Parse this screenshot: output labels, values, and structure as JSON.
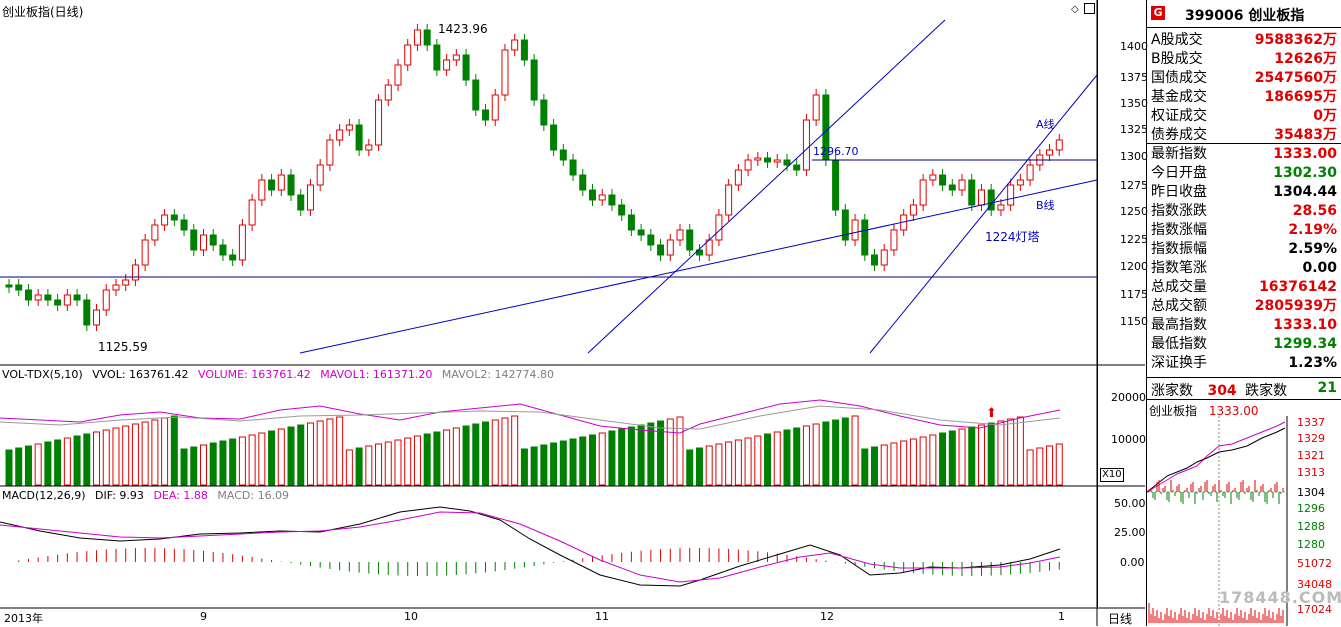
{
  "main_chart": {
    "title": "创业板指(日线)",
    "annotations": {
      "high_label": "1423.96",
      "low_label": "1125.59",
      "level_label": "1296.70",
      "a_line": "A线",
      "b_line": "B线",
      "lamp_label": "1224灯塔"
    },
    "y_ticks": [
      "1400",
      "1375",
      "1350",
      "1325",
      "1300",
      "1275",
      "1250",
      "1225",
      "1200",
      "1175",
      "1150"
    ]
  },
  "volume_panel": {
    "title": "VOL-TDX(5,10)",
    "vvol_label": "VVOL: 163761.42",
    "volume_label": "VOLUME: 163761.42",
    "mavol1_label": "MAVOL1: 161371.20",
    "mavol2_label": "MAVOL2: 142774.80",
    "y_ticks": [
      "20000",
      "10000"
    ],
    "scale_badge": "X10"
  },
  "macd_panel": {
    "title": "MACD(12,26,9)",
    "dif_label": "DIF: 9.93",
    "dea_label": "DEA: 1.88",
    "macd_label": "MACD: 16.09",
    "y_ticks": [
      "50.00",
      "25.00",
      "0.00"
    ]
  },
  "x_axis": {
    "labels": [
      "2013年",
      "9",
      "10",
      "11",
      "12",
      "1"
    ],
    "period_label": "日线"
  },
  "quote": {
    "badge": "G",
    "code": "399006",
    "name": "创业板指",
    "rows": [
      {
        "label": "A股成交",
        "value": "9588362万",
        "color": "red"
      },
      {
        "label": "B股成交",
        "value": "12626万",
        "color": "red"
      },
      {
        "label": "国债成交",
        "value": "2547560万",
        "color": "red"
      },
      {
        "label": "基金成交",
        "value": "186695万",
        "color": "red"
      },
      {
        "label": "权证成交",
        "value": "0万",
        "color": "red"
      },
      {
        "label": "债券成交",
        "value": "35483万",
        "color": "red"
      },
      {
        "label": "最新指数",
        "value": "1333.00",
        "color": "red"
      },
      {
        "label": "今日开盘",
        "value": "1302.30",
        "color": "green"
      },
      {
        "label": "昨日收盘",
        "value": "1304.44",
        "color": "black"
      },
      {
        "label": "指数涨跌",
        "value": "28.56",
        "color": "red"
      },
      {
        "label": "指数涨幅",
        "value": "2.19%",
        "color": "red"
      },
      {
        "label": "指数振幅",
        "value": "2.59%",
        "color": "black"
      },
      {
        "label": "指数笔涨",
        "value": "0.00",
        "color": "black"
      },
      {
        "label": "总成交量",
        "value": "16376142",
        "color": "red"
      },
      {
        "label": "总成交额",
        "value": "2805939万",
        "color": "red"
      },
      {
        "label": "最高指数",
        "value": "1333.10",
        "color": "red"
      },
      {
        "label": "最低指数",
        "value": "1299.34",
        "color": "green"
      },
      {
        "label": "深证换手",
        "value": "1.23%",
        "color": "black"
      }
    ],
    "rise_label": "涨家数",
    "rise_value": "304",
    "fall_label": "跌家数",
    "fall_value": "21"
  },
  "mini_chart": {
    "title": "创业板指",
    "price": "1333.00",
    "y_ticks": [
      "1337",
      "1329",
      "1321",
      "1313",
      "1304",
      "1296",
      "1288",
      "1280",
      "51072",
      "34048",
      "17024"
    ],
    "watermark": "178448.COM"
  },
  "colors": {
    "up": "#e00000",
    "down": "#008000",
    "trend": "#0000c0",
    "ma1": "#cc00cc",
    "grid": "#000000"
  }
}
